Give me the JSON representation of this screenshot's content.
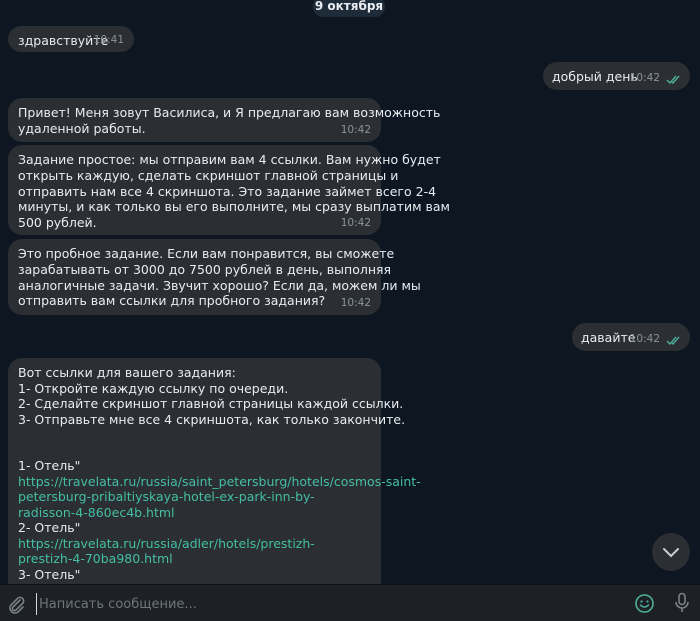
{
  "date_badge": "9 октября",
  "messages": [
    {
      "dir": "in",
      "text": "здравствуйте",
      "time": "10:41"
    },
    {
      "dir": "out",
      "text": "добрый день",
      "time": "10:42"
    },
    {
      "dir": "in",
      "lines": [
        "Привет! Меня зовут Василиса, и Я  предлагаю вам возможность",
        "удаленной работы."
      ],
      "time": "10:42"
    },
    {
      "dir": "in",
      "lines": [
        "Задание простое: мы отправим вам 4 ссылки. Вам нужно будет",
        "открыть каждую, сделать скриншот главной страницы и",
        "отправить нам все 4 скриншота. Это задание займет всего 2-4",
        "минуты, и как только вы его выполните, мы сразу выплатим вам",
        "500 рублей."
      ],
      "time": "10:42"
    },
    {
      "dir": "in",
      "lines": [
        "Это пробное задание. Если вам понравится, вы сможете",
        "зарабатывать от 3000 до 7500 рублей в день, выполняя",
        "аналогичные задачи. Звучит хорошо? Если да, можем ли мы",
        "отправить вам ссылки для пробного задания?"
      ],
      "time": "10:42"
    },
    {
      "dir": "out",
      "text": "давайте",
      "time": "10:42"
    },
    {
      "dir": "in",
      "lines": [
        {
          "t": "Вот ссылки для вашего задания:"
        },
        {
          "t": "1- Откройте каждую ссылку по очереди."
        },
        {
          "t": "2- Сделайте скриншот главной страницы каждой ссылки."
        },
        {
          "t": "3- Отправьте мне все 4 скриншота, как только закончите."
        },
        {
          "t": ""
        },
        {
          "t": ""
        },
        {
          "t": "1- Отель\""
        },
        {
          "t": "https://travelata.ru/russia/saint_petersburg/hotels/cosmos-saint-",
          "link": true
        },
        {
          "t": "petersburg-pribaltiyskaya-hotel-ex-park-inn-by-",
          "link": true
        },
        {
          "t": "radisson-4-860ec4b.html",
          "link": true
        },
        {
          "t": "2- Отель\""
        },
        {
          "t": "https://travelata.ru/russia/adler/hotels/prestizh-",
          "link": true
        },
        {
          "t": "prestizh-4-70ba980.html",
          "link": true
        },
        {
          "t": "3- Отель\""
        }
      ]
    }
  ],
  "composer": {
    "placeholder": "Написать сообщение..."
  },
  "icons": {
    "attach": "paperclip-icon",
    "emoji": "emoji-icon",
    "mic": "microphone-icon",
    "scroll": "chevron-down-icon",
    "read": "double-check-icon"
  },
  "colors": {
    "background": "#0e1621",
    "bubble": "#2b2e33",
    "link": "#44bfa5",
    "check": "#4fae9c"
  }
}
